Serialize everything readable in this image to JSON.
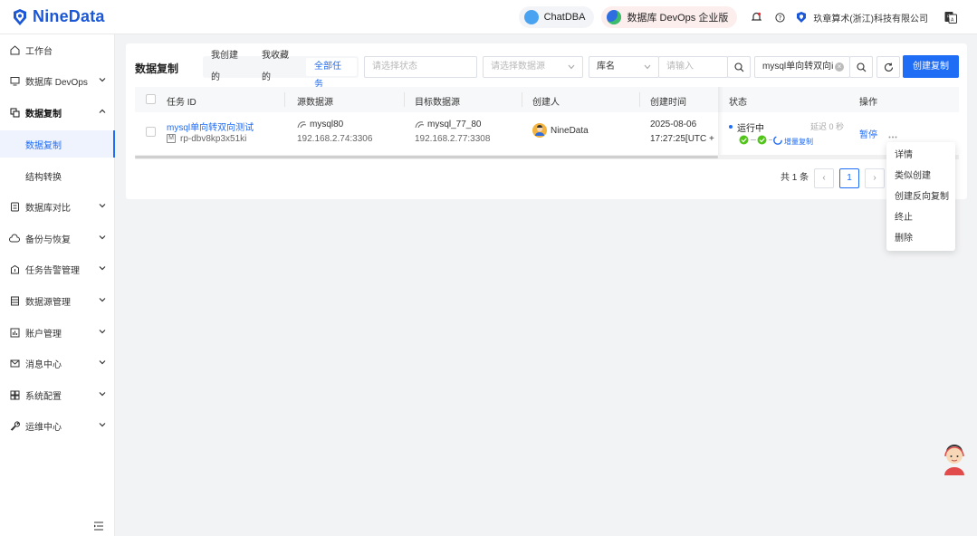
{
  "brand": {
    "name": "NineData",
    "color": "#1b57d6"
  },
  "header": {
    "chatdba": "ChatDBA",
    "devops_edition": "数据库 DevOps 企业版",
    "company": "玖章算术(浙江)科技有限公司",
    "icons": [
      "bell-icon",
      "help-icon",
      "translate-icon"
    ]
  },
  "sidebar": {
    "items": [
      {
        "label": "工作台",
        "icon": "workbench-icon"
      },
      {
        "label": "数据库 DevOps",
        "icon": "monitor-icon"
      },
      {
        "label": "数据复制",
        "icon": "copy-icon"
      },
      {
        "label": "数据库对比",
        "icon": "compare-icon"
      },
      {
        "label": "备份与恢复",
        "icon": "cloud-icon"
      },
      {
        "label": "任务告警管理",
        "icon": "alarm-icon"
      },
      {
        "label": "数据源管理",
        "icon": "datasource-icon"
      },
      {
        "label": "账户管理",
        "icon": "account-icon"
      },
      {
        "label": "消息中心",
        "icon": "message-icon"
      },
      {
        "label": "系统配置",
        "icon": "settings-icon"
      },
      {
        "label": "运维中心",
        "icon": "wrench-icon"
      }
    ],
    "sub": [
      {
        "label": "数据复制"
      },
      {
        "label": "结构转换"
      }
    ]
  },
  "main": {
    "title": "数据复制",
    "segments": [
      "我创建的",
      "我收藏的",
      "全部任务"
    ],
    "filters": {
      "status_placeholder": "请选择状态",
      "source_placeholder": "请选择数据源",
      "db_field": "库名",
      "input_placeholder": "请输入",
      "search_value": "mysql单向转双向i"
    },
    "create_label": "创建复制",
    "columns": [
      "任务 ID",
      "源数据源",
      "目标数据源",
      "创建人",
      "创建时间",
      "状态",
      "操作"
    ],
    "row": {
      "task_name": "mysql单向转双向测试",
      "task_id": "rp-dbv8kp3x51ki",
      "id_badge": "M",
      "src_name": "mysql80",
      "src_addr": "192.168.2.74:3306",
      "dst_name": "mysql_77_80",
      "dst_addr": "192.168.2.77:3308",
      "creator": "NineData",
      "created_date": "2025-08-06",
      "created_time": "17:27:25[UTC +",
      "status": "运行中",
      "delay": "延迟 0 秒",
      "phase": "增量复制",
      "action": "暂停"
    },
    "pagination": {
      "total": "共 1 条",
      "current": "1"
    }
  },
  "menu": {
    "items": [
      "详情",
      "类似创建",
      "创建反向复制",
      "终止",
      "删除"
    ]
  },
  "colors": {
    "primary": "#1f6cf5",
    "success": "#52c41a"
  }
}
